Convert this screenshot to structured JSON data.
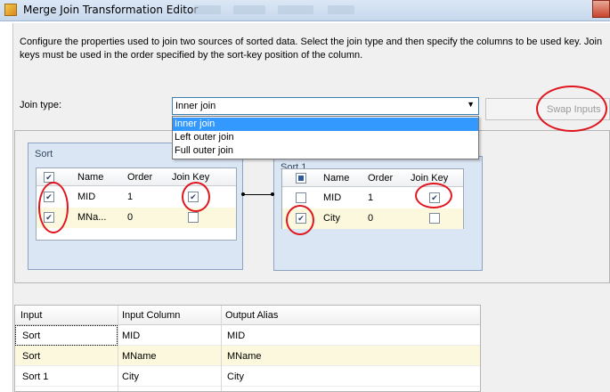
{
  "window": {
    "title": "Merge Join Transformation Editor"
  },
  "description": "Configure the properties used to join two sources of sorted data. Select the join type and then specify the columns to be used key. Join keys must be used in the order specified by the sort-key position of the column.",
  "join_type": {
    "label": "Join type:",
    "selected": "Inner join",
    "options": [
      "Inner join",
      "Left outer join",
      "Full outer join"
    ]
  },
  "swap_button": {
    "label": "Swap Inputs",
    "enabled": false
  },
  "inputs": [
    {
      "title": "Sort",
      "headers": [
        "Name",
        "Order",
        "Join Key"
      ],
      "rows": [
        {
          "name": "MID",
          "order": "1",
          "selected": true,
          "join_key": true
        },
        {
          "name": "MNa...",
          "order": "0",
          "selected": true,
          "join_key": false
        }
      ]
    },
    {
      "title": "Sort 1",
      "headers": [
        "Name",
        "Order",
        "Join Key"
      ],
      "rows": [
        {
          "name": "MID",
          "order": "1",
          "selected": false,
          "join_key": true
        },
        {
          "name": "City",
          "order": "0",
          "selected": true,
          "join_key": false
        }
      ]
    }
  ],
  "output": {
    "headers": [
      "Input",
      "Input Column",
      "Output Alias"
    ],
    "rows": [
      {
        "input": "Sort",
        "column": "MID",
        "alias": "MID"
      },
      {
        "input": "Sort",
        "column": "MName",
        "alias": "MName"
      },
      {
        "input": "Sort 1",
        "column": "City",
        "alias": "City"
      }
    ]
  },
  "colors": {
    "annotation": "#e0161f",
    "selection": "#3399ff",
    "row_alt": "#fbf8dd"
  }
}
